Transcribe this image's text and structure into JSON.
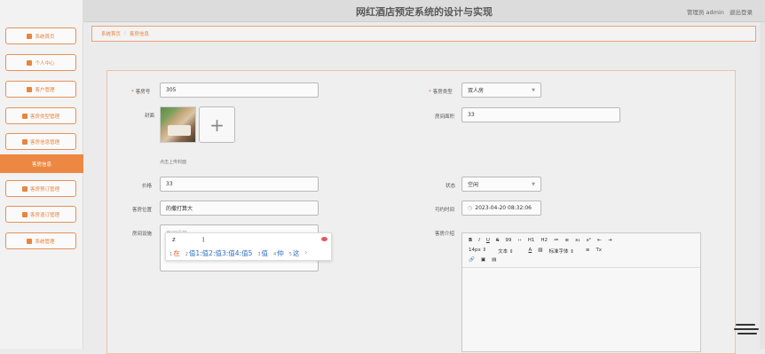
{
  "app": {
    "title": "网红酒店预定系统的设计与实现",
    "user_text": "管理员 admin",
    "logout": "退出登录"
  },
  "sidebar": {
    "items": [
      {
        "label": "系统首页",
        "icon": "home-icon"
      },
      {
        "label": "个人中心",
        "icon": "user-icon"
      },
      {
        "label": "客户管理",
        "icon": "grid-icon"
      },
      {
        "label": "客房类型管理",
        "icon": "grid-icon"
      },
      {
        "label": "客房信息管理",
        "icon": "grid-icon"
      },
      {
        "label": "客房信息",
        "icon": ""
      },
      {
        "label": "客房预订管理",
        "icon": "grid-icon"
      },
      {
        "label": "客房退订管理",
        "icon": "grid-icon"
      },
      {
        "label": "系统管理",
        "icon": "grid-icon"
      }
    ]
  },
  "breadcrumb": {
    "home": "系统首页",
    "sep": "/",
    "current": "客房信息"
  },
  "form": {
    "room_no": {
      "label": "客房号",
      "value": "305"
    },
    "room_type": {
      "label": "客房类型",
      "value": "双人房"
    },
    "cover": {
      "label": "封面",
      "hint": "点击上传封面"
    },
    "area": {
      "label": "房间面积",
      "value": "33"
    },
    "price": {
      "label": "价格",
      "value": "33"
    },
    "status": {
      "label": "状态",
      "value": "空闲"
    },
    "location": {
      "label": "客房位置",
      "value": "的撒打算大"
    },
    "bookable_time": {
      "label": "可约时间",
      "value": "2023-04-20 08:32:06"
    },
    "facilities": {
      "label": "房间设施",
      "placeholder": "房间设施"
    },
    "intro": {
      "label": "客房介绍"
    }
  },
  "ime": {
    "typed": "z",
    "candidates": [
      {
        "n": "1",
        "text": "在"
      },
      {
        "n": "2",
        "text": "值1:值2:值3:值4:值5"
      },
      {
        "n": "3",
        "text": "值"
      },
      {
        "n": "4",
        "text": "仲"
      },
      {
        "n": "5",
        "text": "这"
      }
    ],
    "more": "›"
  },
  "editor": {
    "row1": [
      "B",
      "I",
      "U",
      "S",
      "99",
      "‹›",
      "H1",
      "H2",
      "≔",
      "≡",
      "x₂",
      "x²",
      "⇤",
      "⇥"
    ],
    "size": "14px",
    "text_style": "文本",
    "color": "A",
    "font_family": "标准字体",
    "clean": "Tx",
    "row3": [
      "🔗",
      "▣",
      "▤"
    ]
  },
  "colors": {
    "accent": "#ec8841",
    "border": "#e4925a"
  }
}
